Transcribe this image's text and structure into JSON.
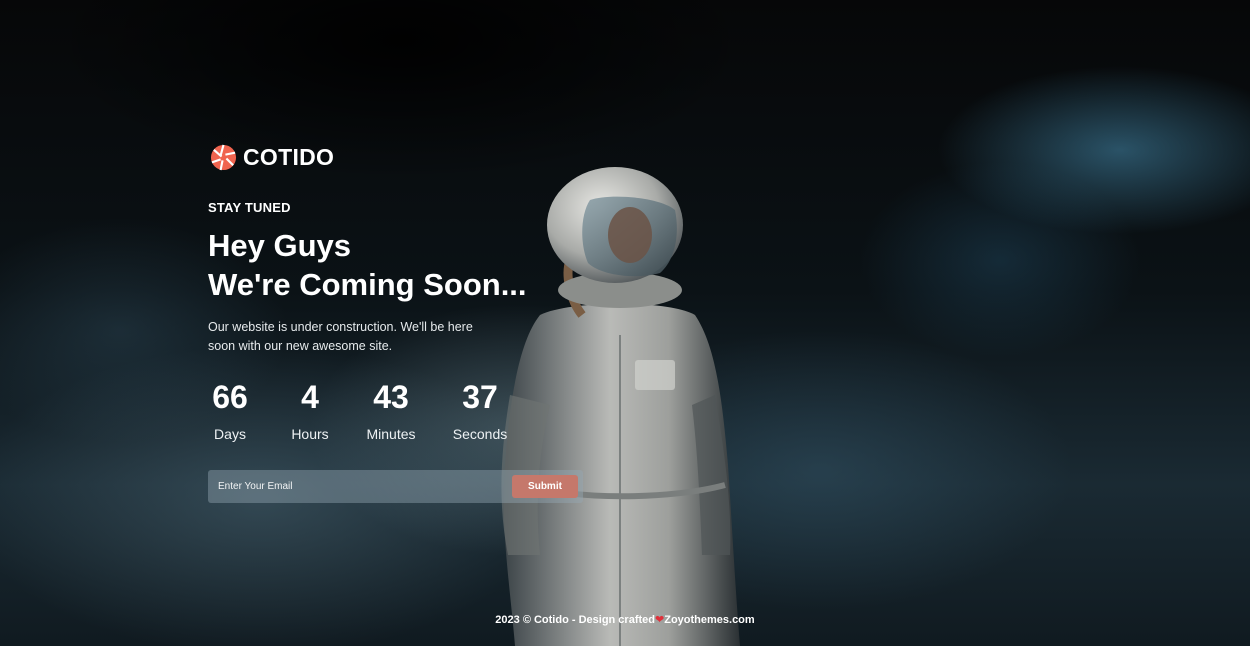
{
  "brand": {
    "name": "COTIDO",
    "accent_color": "#f0644f",
    "logo_icon": "aperture-icon"
  },
  "hero": {
    "eyebrow": "STAY TUNED",
    "headline_line1": "Hey Guys",
    "headline_line2": "We're Coming Soon...",
    "description": "Our website is under construction. We'll be here soon with our new awesome site."
  },
  "countdown": [
    {
      "value": "66",
      "label": "Days"
    },
    {
      "value": "4",
      "label": "Hours"
    },
    {
      "value": "43",
      "label": "Minutes"
    },
    {
      "value": "37",
      "label": "Seconds"
    }
  ],
  "subscribe": {
    "email_placeholder": "Enter Your Email",
    "email_value": "",
    "submit_label": "Submit",
    "button_color": "#c5786b"
  },
  "footer": {
    "text_before": "2023 © Cotido - Design crafted",
    "heart_icon": "heart-icon",
    "text_after": "Zoyothemes.com"
  }
}
